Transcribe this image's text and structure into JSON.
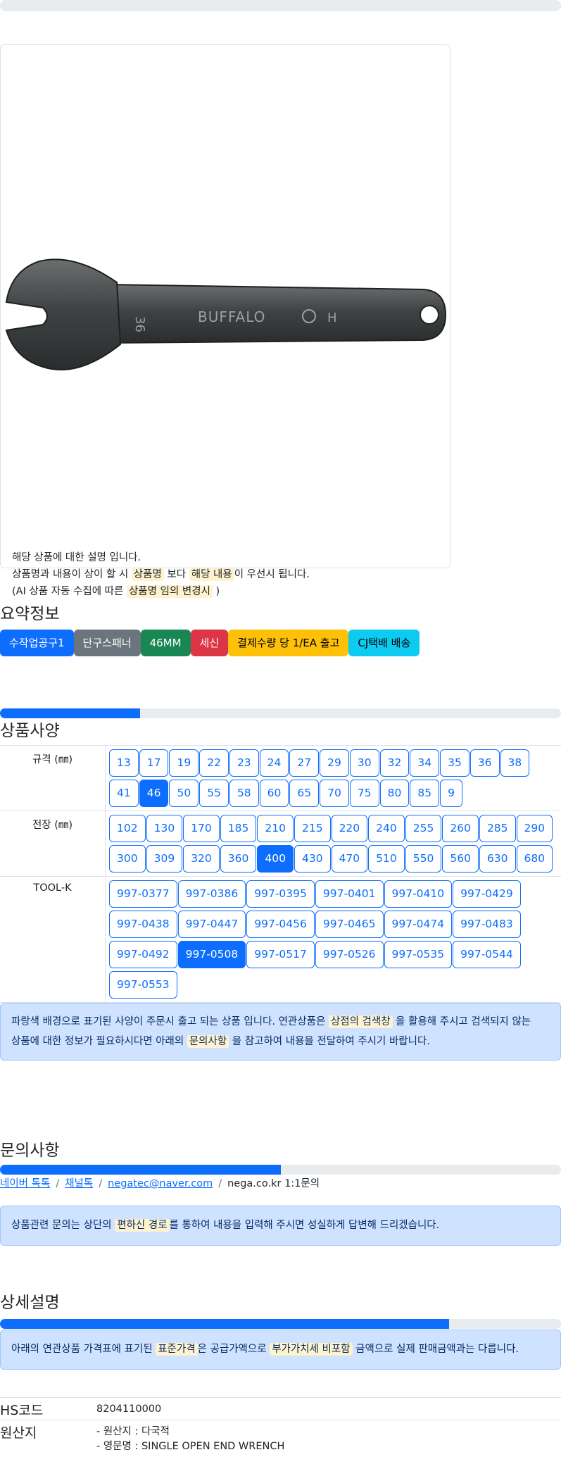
{
  "card": {
    "desc_line1": "해당 상품에 대한 설명 입니다.",
    "desc_line2_pre": "상품명과 내용이 상이 할 시 ",
    "desc_line2_hl1": "상품명",
    "desc_line2_mid": " 보다 ",
    "desc_line2_hl2": "해당 내용",
    "desc_line2_post": "이 우선시 됩니다.",
    "desc_line3_pre": "(AI 상품 자동 수집에 따른 ",
    "desc_line3_hl": "상품명 임의 변경시",
    "desc_line3_post": " )"
  },
  "product_image": {
    "engraving": "BUFFALO",
    "size_mark": "36",
    "mark": "H"
  },
  "summary": {
    "title": "요약정보",
    "badges": [
      {
        "label": "수작업공구1",
        "color": "#0d6efd",
        "text": "#ffffff"
      },
      {
        "label": "단구스패너",
        "color": "#6c757d",
        "text": "#ffffff"
      },
      {
        "label": "46MM",
        "color": "#198754",
        "text": "#ffffff"
      },
      {
        "label": "세신",
        "color": "#dc3545",
        "text": "#ffffff"
      },
      {
        "label": "결제수량 당 1/EA 출고",
        "color": "#ffc107",
        "text": "#000000"
      },
      {
        "label": "CJ택배 배송",
        "color": "#0dcaf0",
        "text": "#000000"
      }
    ]
  },
  "spec": {
    "title": "상품사양",
    "progress": 0.25,
    "rows": [
      {
        "label": "규격 (㎜)",
        "active": "46",
        "options": [
          "13",
          "17",
          "19",
          "22",
          "23",
          "24",
          "27",
          "29",
          "30",
          "32",
          "34",
          "35",
          "36",
          "38",
          "41",
          "46",
          "50",
          "55",
          "58",
          "60",
          "65",
          "70",
          "75",
          "80",
          "85",
          "9"
        ]
      },
      {
        "label": "전장 (㎜)",
        "active": "400",
        "options": [
          "102",
          "130",
          "170",
          "185",
          "210",
          "215",
          "220",
          "240",
          "255",
          "260",
          "285",
          "290",
          "300",
          "309",
          "320",
          "360",
          "400",
          "430",
          "470",
          "510",
          "550",
          "560",
          "630",
          "680"
        ]
      },
      {
        "label": "TOOL-K",
        "active": "997-0508",
        "options": [
          "997-0377",
          "997-0386",
          "997-0395",
          "997-0401",
          "997-0410",
          "997-0429",
          "997-0438",
          "997-0447",
          "997-0456",
          "997-0465",
          "997-0474",
          "997-0483",
          "997-0492",
          "997-0508",
          "997-0517",
          "997-0526",
          "997-0535",
          "997-0544",
          "997-0553"
        ]
      }
    ],
    "notice_pre": "파랑색 배경으로 표기된 사양이 주문시 출고 되는 상품 입니다. 연관상품은 ",
    "notice_hl1": "상점의 검색창",
    "notice_mid": " 을 활용해 주시고 검색되지 않는",
    "notice_line2_pre": "상품에 대한 정보가 필요하시다면 아래의 ",
    "notice_hl2": "문의사항",
    "notice_post": " 을 참고하여 내용을 전달하여 주시기 바랍니다."
  },
  "inquiry": {
    "title": "문의사항",
    "progress": 0.5,
    "links": [
      "네이버 톡톡",
      "채널톡",
      "negatec@naver.com"
    ],
    "plain": "nega.co.kr 1:1문의",
    "separator": "/",
    "notice_pre": "상품관련 문의는 상단의 ",
    "notice_hl": "편하신 경로",
    "notice_post": "를 통하여 내용을 입력해 주시면 성실하게 답변해 드리겠습니다."
  },
  "detail": {
    "title": "상세설명",
    "progress": 0.8,
    "notice_pre": "아래의 연관상품 가격표에 표기된 ",
    "notice_hl1": "표준가격",
    "notice_mid": "은 공급가액으로 ",
    "notice_hl2": "부가가치세 비포함",
    "notice_post": " 금액으로 실제 판매금액과는 다릅니다.",
    "hs_label": "HS코드",
    "hs_value": "8204110000",
    "origin_label": "원산지",
    "origin_line1": "- 원산지 : 다국적",
    "origin_line2": "- 영문명 : SINGLE OPEN END WRENCH"
  }
}
